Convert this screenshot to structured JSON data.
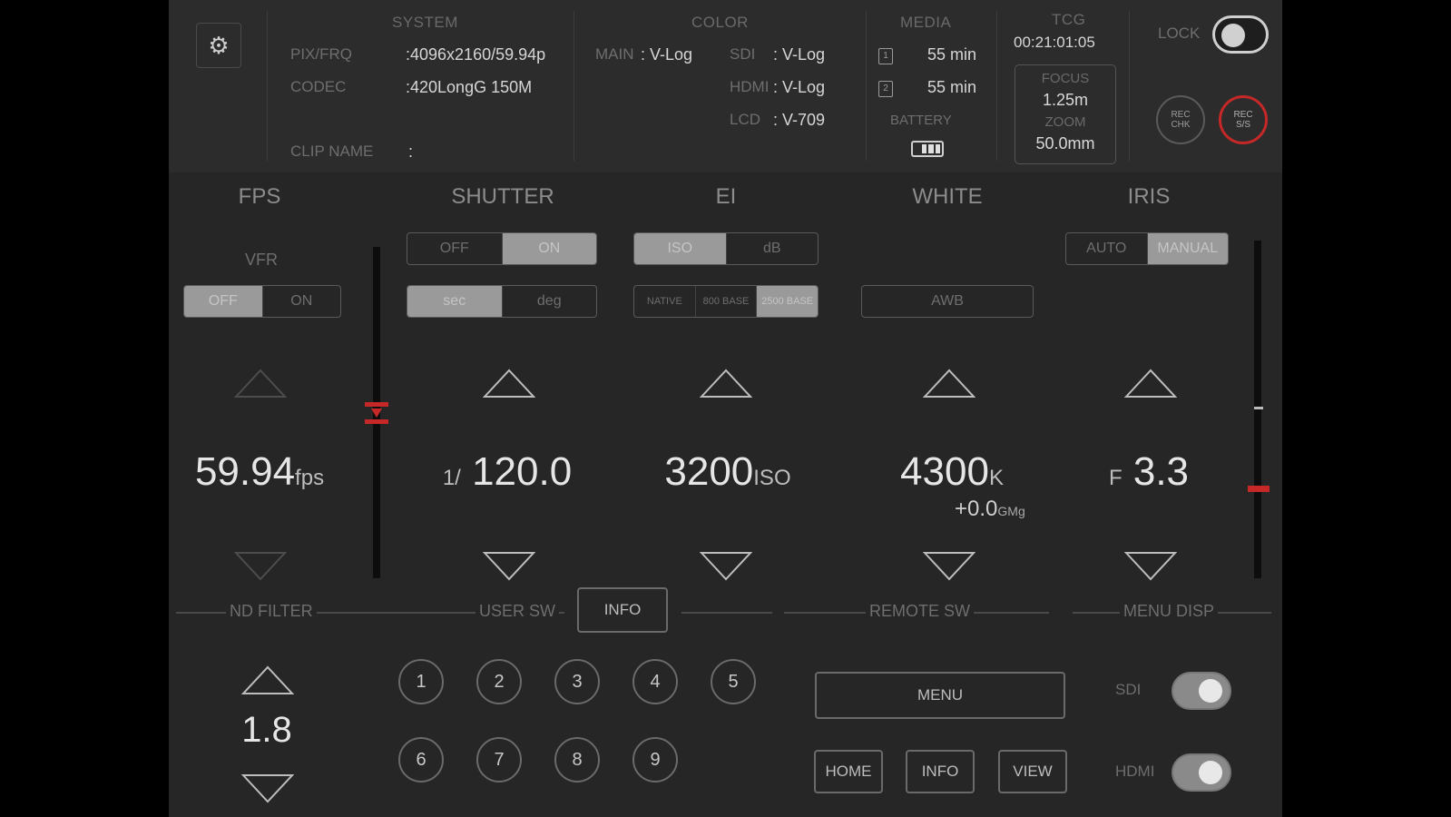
{
  "system": {
    "title": "SYSTEM",
    "pix_frq_label": "PIX/FRQ",
    "pix_frq_value": ":4096x2160/59.94p",
    "codec_label": "CODEC",
    "codec_value": ":420LongG 150M",
    "clip_name_label": "CLIP NAME",
    "clip_name_value": ":"
  },
  "color": {
    "title": "COLOR",
    "main_label": "MAIN",
    "main_value": ": V-Log",
    "sdi_label": "SDI",
    "sdi_value": ": V-Log",
    "hdmi_label": "HDMI",
    "hdmi_value": ": V-Log",
    "lcd_label": "LCD",
    "lcd_value": ": V-709"
  },
  "media": {
    "title": "MEDIA",
    "slot1_icon": "1",
    "slot1_value": "55 min",
    "slot2_icon": "2",
    "slot2_value": "55 min",
    "battery_label": "BATTERY",
    "battery_level": 0.75
  },
  "tcg": {
    "title": "TCG",
    "value": "00:21:01:05",
    "focus_label": "FOCUS",
    "focus_value": "1.25m",
    "zoom_label": "ZOOM",
    "zoom_value": "50.0mm"
  },
  "lock": {
    "label": "LOCK",
    "state": "off"
  },
  "rec": {
    "check_line1": "REC",
    "check_line2": "CHK",
    "ss_line1": "REC",
    "ss_line2": "S/S"
  },
  "fps": {
    "title": "FPS",
    "vfr_label": "VFR",
    "vfr_options": [
      "OFF",
      "ON"
    ],
    "value": "59.94",
    "unit": "fps"
  },
  "shutter": {
    "title": "SHUTTER",
    "onoff_options": [
      "OFF",
      "ON"
    ],
    "mode_options": [
      "sec",
      "deg"
    ],
    "prefix": "1/",
    "value": "120.0"
  },
  "ei": {
    "title": "EI",
    "mode_options": [
      "ISO",
      "dB"
    ],
    "base_options": [
      "NATIVE",
      "800 BASE",
      "2500 BASE"
    ],
    "value": "3200",
    "unit": "ISO"
  },
  "white": {
    "title": "WHITE",
    "awb_label": "AWB",
    "value": "4300",
    "unit": "K",
    "gmg_value": "+0.0",
    "gmg_unit": "GMg"
  },
  "iris": {
    "title": "IRIS",
    "mode_options": [
      "AUTO",
      "MANUAL"
    ],
    "prefix": "F",
    "value": "3.3"
  },
  "bottom": {
    "nd_filter_label": "ND FILTER",
    "nd_value": "1.8",
    "user_sw_label": "USER SW",
    "info_button": "INFO",
    "user_buttons": [
      "1",
      "2",
      "3",
      "4",
      "5",
      "6",
      "7",
      "8",
      "9"
    ],
    "remote_sw_label": "REMOTE SW",
    "menu_button": "MENU",
    "home_button": "HOME",
    "remote_info_button": "INFO",
    "view_button": "VIEW",
    "menu_disp_label": "MENU DISP",
    "sdi_label": "SDI",
    "hdmi_label": "HDMI"
  },
  "colors": {
    "accent_red": "#c62828",
    "panel_bg": "#262626"
  }
}
